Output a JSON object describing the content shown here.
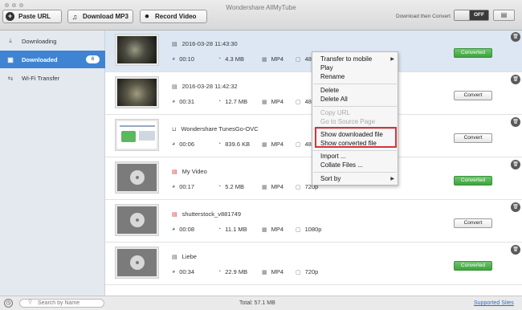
{
  "window": {
    "title": "Wondershare AllMyTube"
  },
  "toolbar": {
    "paste_url": "Paste URL",
    "download_mp3": "Download MP3",
    "record_video": "Record Video",
    "download_then_convert": "Download then Convert",
    "toggle_state": "OFF",
    "view_toggle": "▤"
  },
  "sidebar": {
    "items": [
      {
        "label": "Downloading",
        "icon": "download-icon"
      },
      {
        "label": "Downloaded",
        "icon": "downloaded-icon",
        "badge": "6"
      },
      {
        "label": "Wi-Fi Transfer",
        "icon": "wifi-transfer-icon"
      }
    ]
  },
  "rows": [
    {
      "title": "2016-03-28 11:43:30",
      "duration": "00:10",
      "size": "4.3 MB",
      "format": "MP4",
      "res": "48",
      "action": "Converted",
      "status": "converted",
      "selected": true
    },
    {
      "title": "2016-03-28 11:42:32",
      "duration": "00:31",
      "size": "12.7 MB",
      "format": "MP4",
      "res": "48",
      "action": "Convert",
      "status": "convert"
    },
    {
      "title": "Wondershare TunesGo-OVC",
      "duration": "00:06",
      "size": "839.6 KB",
      "format": "MP4",
      "res": "48",
      "action": "Convert",
      "status": "convert"
    },
    {
      "title": "My Video",
      "duration": "00:17",
      "size": "5.2 MB",
      "format": "MP4",
      "res": "720p",
      "action": "Converted",
      "status": "converted"
    },
    {
      "title": "shutterstock_v881749",
      "duration": "00:08",
      "size": "11.1 MB",
      "format": "MP4",
      "res": "1080p",
      "action": "Convert",
      "status": "convert"
    },
    {
      "title": "Liebe",
      "duration": "00:34",
      "size": "22.9 MB",
      "format": "MP4",
      "res": "720p",
      "action": "Converted",
      "status": "converted"
    }
  ],
  "context_menu": {
    "transfer_to_mobile": "Transfer to mobile",
    "play": "Play",
    "rename": "Rename",
    "delete": "Delete",
    "delete_all": "Delete All",
    "copy_url": "Copy URL",
    "go_to_source": "Go to Source Page",
    "show_downloaded": "Show downloaded file",
    "show_converted": "Show converted file",
    "import": "Import ...",
    "collate_files": "Collate Files ...",
    "sort_by": "Sort by"
  },
  "status": {
    "search_placeholder": "Search by Name",
    "total": "Total: 57.1 MB",
    "supported_sites": "Supported Sites"
  },
  "colors": {
    "accent": "#3e84d2",
    "converted": "#4cae4c",
    "highlight": "#d2343a",
    "selected_row": "#dde7f4"
  }
}
